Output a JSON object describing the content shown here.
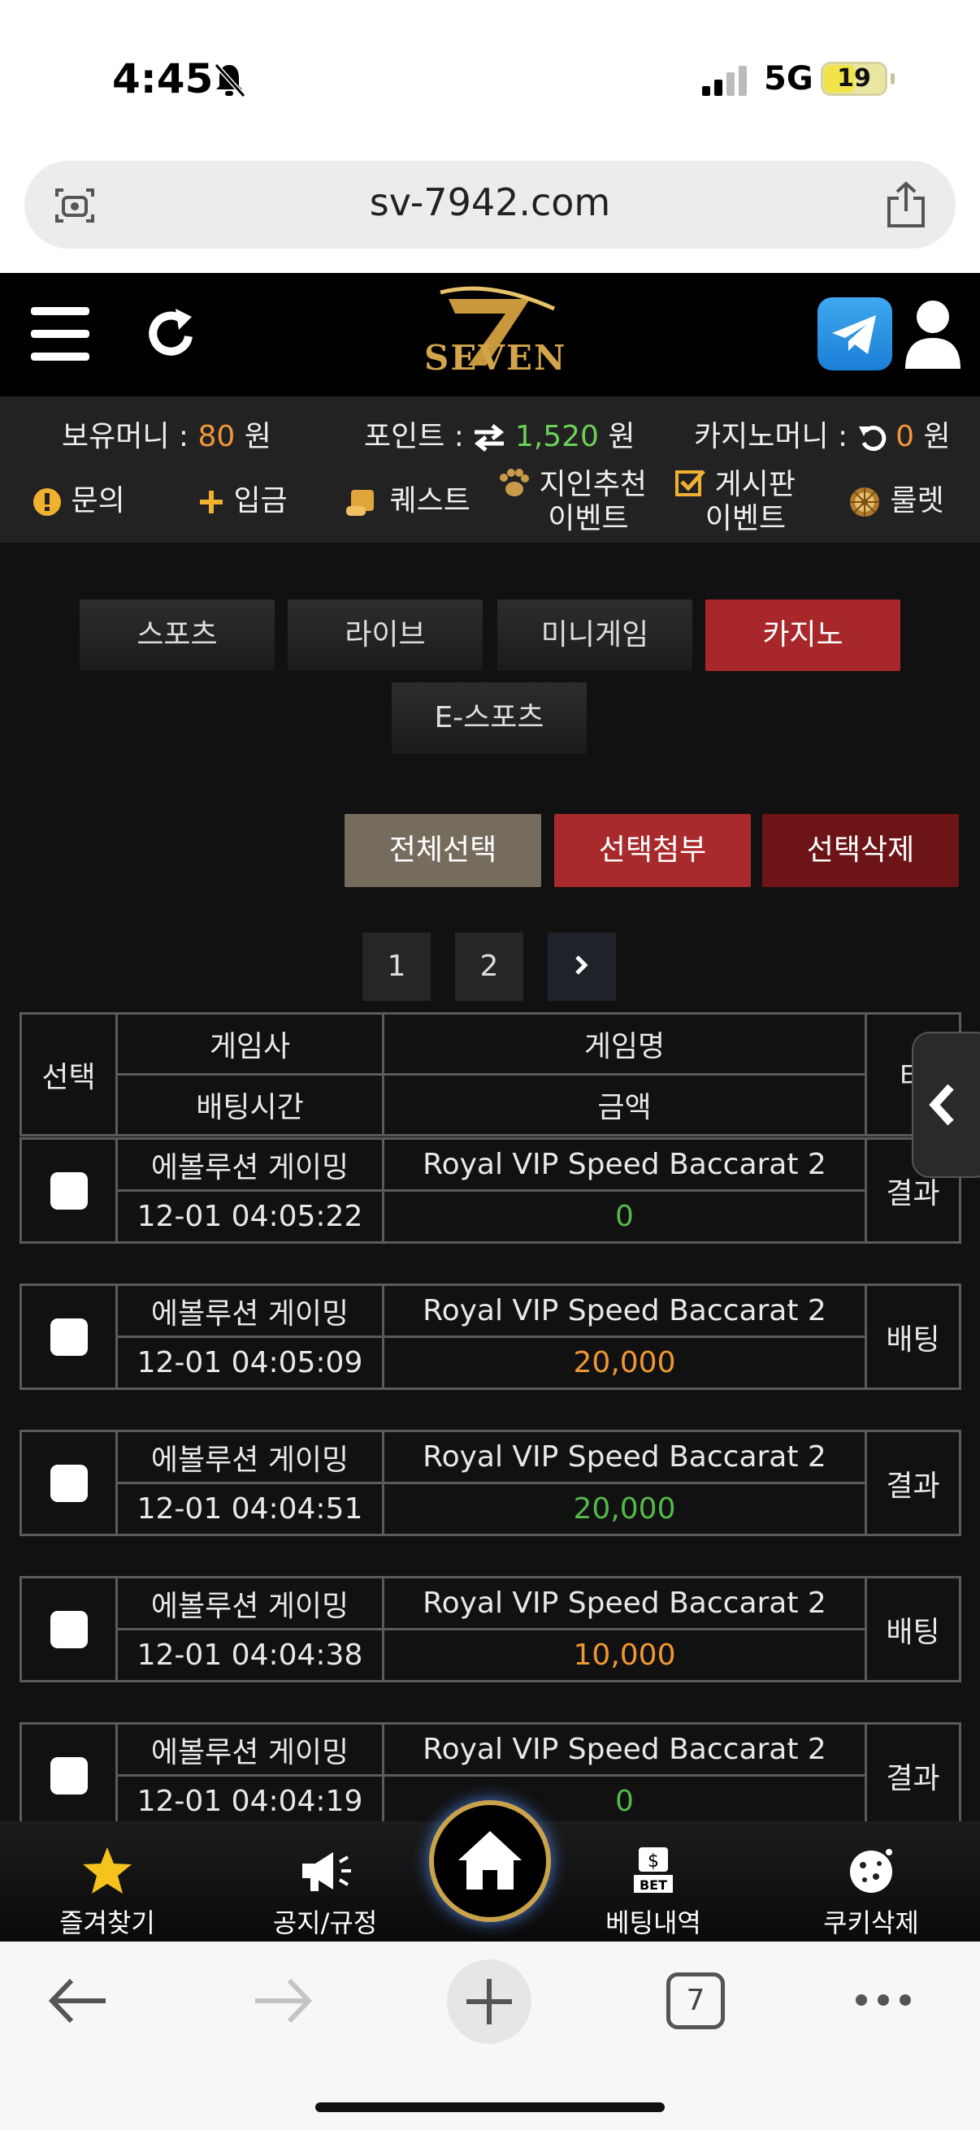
{
  "status": {
    "time": "4:45",
    "network": "5G",
    "battery": "19"
  },
  "browser": {
    "url": "sv-7942.com",
    "tab_count": "7"
  },
  "header": {
    "logo_text": "SEVEN"
  },
  "wallet": {
    "money_label": "보유머니 :",
    "money_value": "80",
    "money_unit": "원",
    "point_label": "포인트 :",
    "point_value": "1,520",
    "point_unit": "원",
    "casino_label": "카지노머니 :",
    "casino_value": "0",
    "casino_unit": "원"
  },
  "menu": {
    "inquiry": "문의",
    "deposit": "입금",
    "quest": "퀘스트",
    "referral_line1": "지인추천",
    "referral_line2": "이벤트",
    "board_line1": "게시판",
    "board_line2": "이벤트",
    "roulette": "룰렛"
  },
  "tabs": {
    "sports": "스포츠",
    "live": "라이브",
    "minigame": "미니게임",
    "casino": "카지노",
    "esports": "E-스포츠"
  },
  "actions": {
    "select_all": "전체선택",
    "attach": "선택첨부",
    "delete": "선택삭제"
  },
  "pagination": {
    "p1": "1",
    "p2": "2"
  },
  "table_header": {
    "select": "선택",
    "provider": "게임사",
    "game": "게임명",
    "type": "타",
    "bet_time": "배팅시간",
    "amount": "금액"
  },
  "rows": [
    {
      "provider": "에볼루션 게이밍",
      "game": "Royal VIP Speed Baccarat 2",
      "time": "12-01 04:05:22",
      "amount": "0",
      "amount_color": "green",
      "type": "결과"
    },
    {
      "provider": "에볼루션 게이밍",
      "game": "Royal VIP Speed Baccarat 2",
      "time": "12-01 04:05:09",
      "amount": "20,000",
      "amount_color": "orange",
      "type": "배팅"
    },
    {
      "provider": "에볼루션 게이밍",
      "game": "Royal VIP Speed Baccarat 2",
      "time": "12-01 04:04:51",
      "amount": "20,000",
      "amount_color": "green",
      "type": "결과"
    },
    {
      "provider": "에볼루션 게이밍",
      "game": "Royal VIP Speed Baccarat 2",
      "time": "12-01 04:04:38",
      "amount": "10,000",
      "amount_color": "orange",
      "type": "배팅"
    },
    {
      "provider": "에볼루션 게이밍",
      "game": "Royal VIP Speed Baccarat 2",
      "time": "12-01 04:04:19",
      "amount": "0",
      "amount_color": "green",
      "type": "결과"
    }
  ],
  "bottom_nav": {
    "favorites": "즐겨찾기",
    "notice": "공지/규정",
    "bet_history": "베팅내역",
    "cookie_delete": "쿠키삭제"
  },
  "colors": {
    "accent_red": "#a8272b",
    "amount_green": "#55b84a",
    "amount_orange": "#ef9736",
    "point_green": "#6bd058",
    "gold": "#c9a24a"
  }
}
